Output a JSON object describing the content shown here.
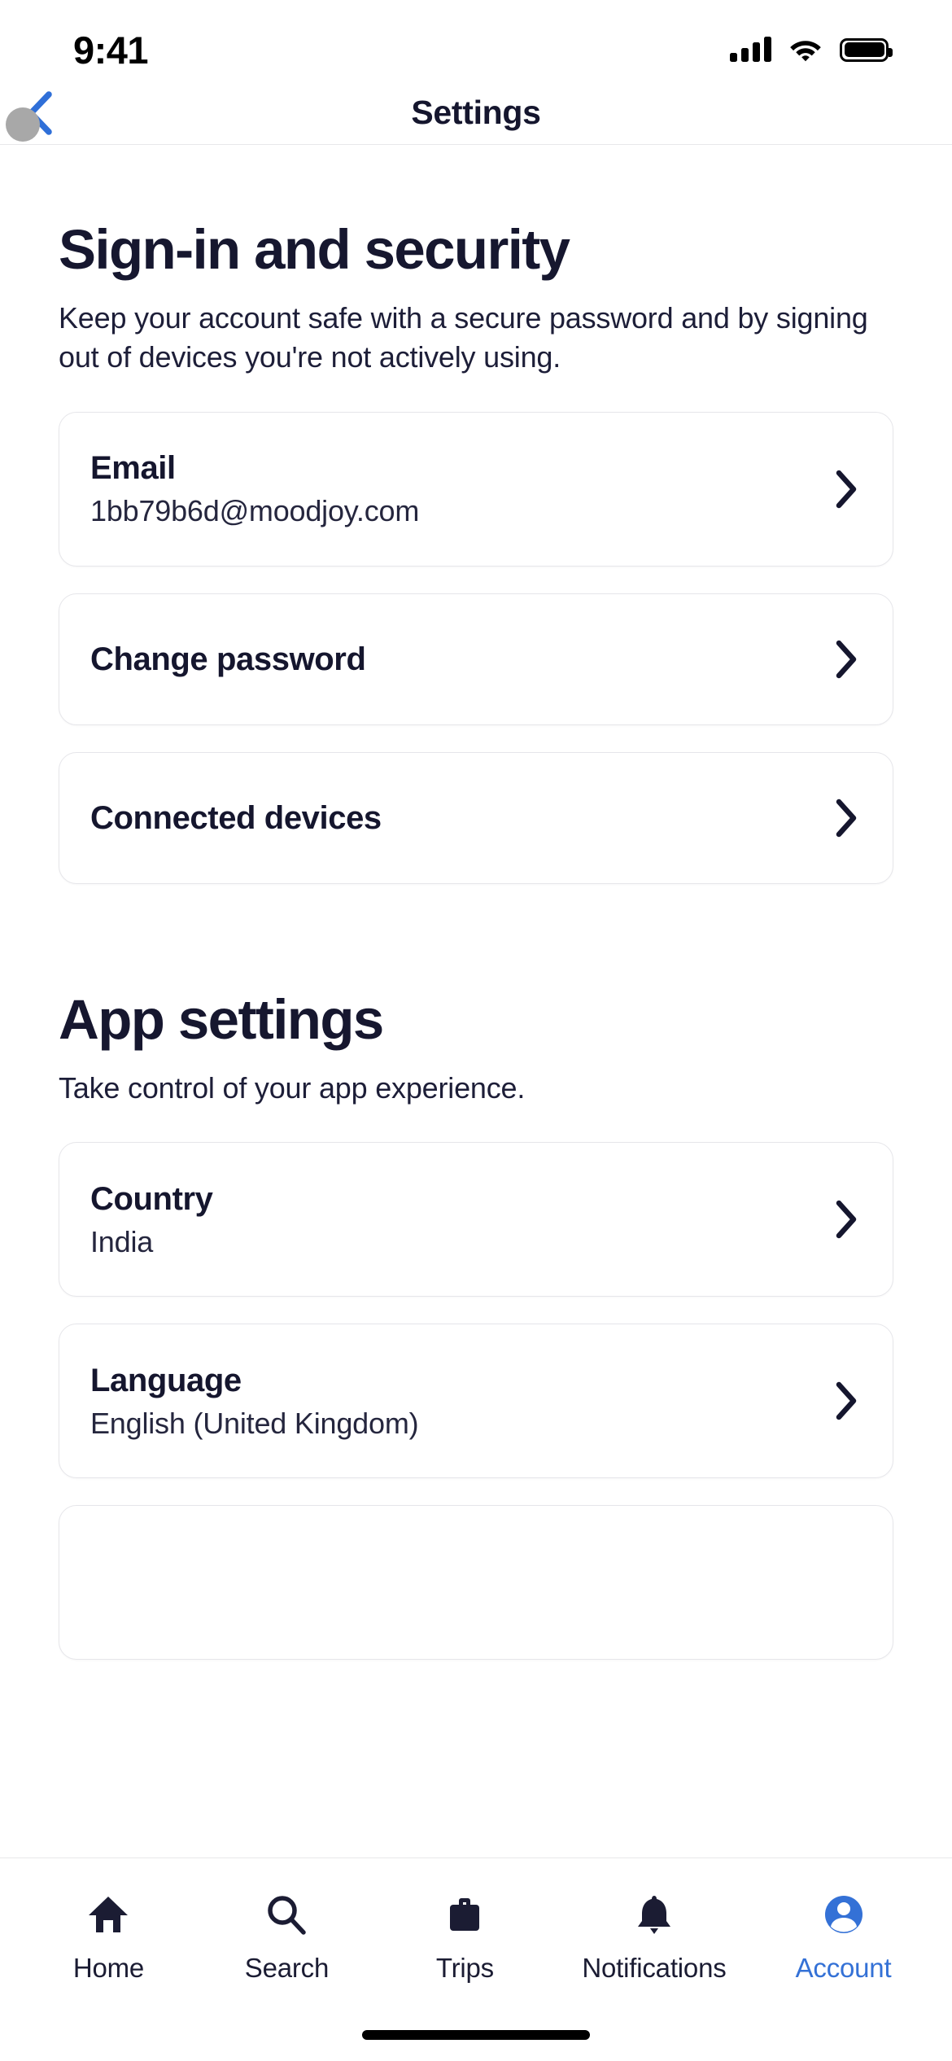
{
  "status_bar": {
    "time": "9:41",
    "icons": [
      "cellular-signal-icon",
      "wifi-icon",
      "battery-icon"
    ]
  },
  "nav": {
    "title": "Settings",
    "back_icon": "chevron-left-icon",
    "back_color": "#2f6fd8"
  },
  "colors": {
    "heading": "#16172f",
    "body": "#1d1e38",
    "accent": "#3471d6",
    "card_border": "#e6e6ea",
    "divider": "#e8e8ea",
    "cursor": "#a8a8a8"
  },
  "sections": [
    {
      "title": "Sign-in and security",
      "description": "Keep your account safe with a secure password and by signing out of devices you're not actively using.",
      "cards": [
        {
          "label": "Email",
          "value": "1bb79b6d@moodjoy.com",
          "chevron": "chevron-right-icon"
        },
        {
          "label": "Change password",
          "value": "",
          "chevron": "chevron-right-icon"
        },
        {
          "label": "Connected devices",
          "value": "",
          "chevron": "chevron-right-icon"
        }
      ]
    },
    {
      "title": "App settings",
      "description": "Take control of your app experience.",
      "cards": [
        {
          "label": "Country",
          "value": "India",
          "chevron": "chevron-right-icon"
        },
        {
          "label": "Language",
          "value": "English (United Kingdom)",
          "chevron": "chevron-right-icon"
        },
        {
          "label": "",
          "value": "",
          "chevron": "chevron-right-icon"
        }
      ]
    }
  ],
  "tabbar": {
    "items": [
      {
        "label": "Home",
        "icon": "home-icon",
        "active": false
      },
      {
        "label": "Search",
        "icon": "search-icon",
        "active": false
      },
      {
        "label": "Trips",
        "icon": "suitcase-icon",
        "active": false
      },
      {
        "label": "Notifications",
        "icon": "bell-icon",
        "active": false
      },
      {
        "label": "Account",
        "icon": "account-circle-icon",
        "active": true
      }
    ]
  }
}
